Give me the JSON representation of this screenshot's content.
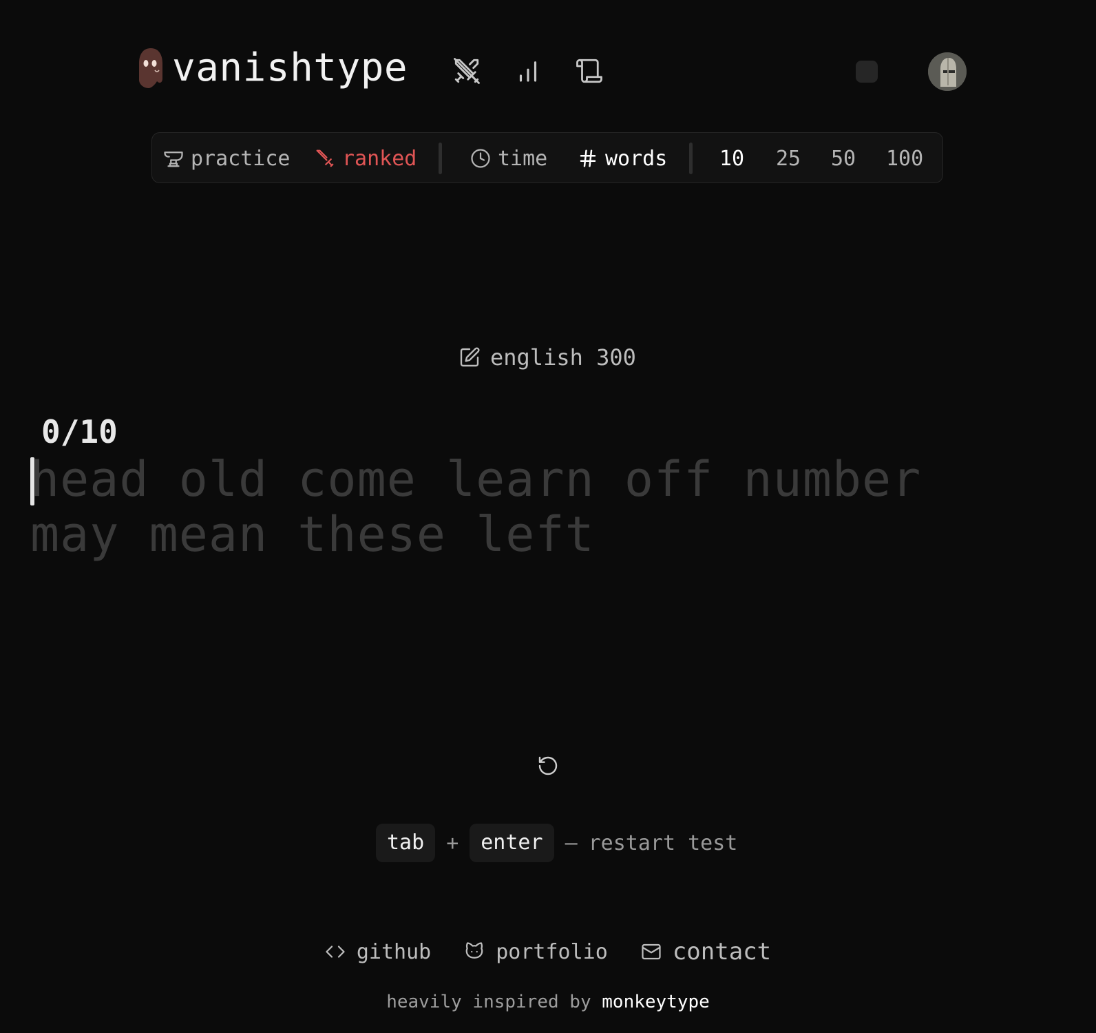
{
  "header": {
    "brand": "vanishtype",
    "nav": [
      {
        "icon": "swords-off-icon"
      },
      {
        "icon": "bar-chart-icon"
      },
      {
        "icon": "scroll-icon"
      }
    ]
  },
  "config": {
    "practice_label": "practice",
    "ranked_label": "ranked",
    "time_label": "time",
    "words_label": "words",
    "counts": [
      "10",
      "25",
      "50",
      "100"
    ],
    "selected_count": "10",
    "ranked_color": "#e05555"
  },
  "test": {
    "language": "english 300",
    "progress": "0/10",
    "line1": "head old come learn off number",
    "line2": "may mean these left"
  },
  "hint": {
    "key1": "tab",
    "plus": "+",
    "key2": "enter",
    "dash": "–",
    "action": "restart test"
  },
  "footer": {
    "github": "github",
    "portfolio": "portfolio",
    "contact": "contact",
    "credit_prefix": "heavily inspired by",
    "credit_link": "monkeytype"
  }
}
